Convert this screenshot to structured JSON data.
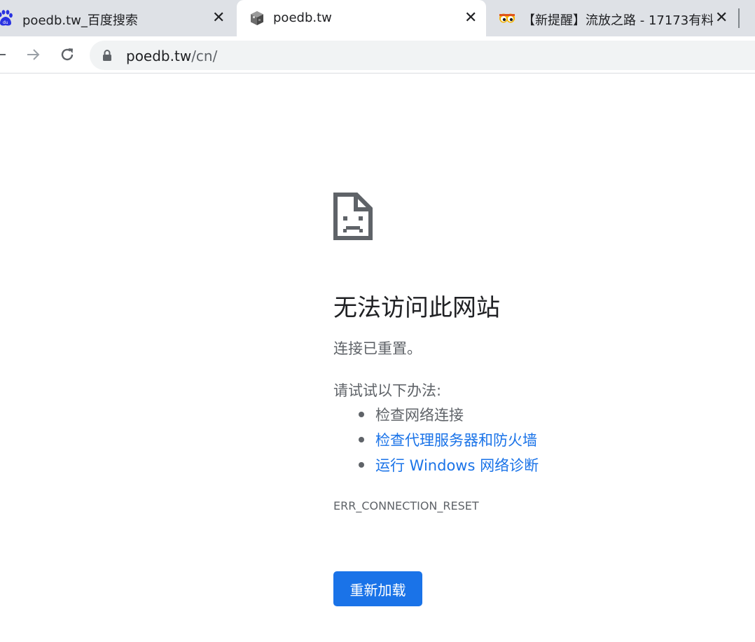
{
  "tabs": [
    {
      "title": "poedb.tw_百度搜索",
      "favicon": "baidu-paw-icon",
      "active": false
    },
    {
      "title": "poedb.tw",
      "favicon": "poedb-cube-icon",
      "active": true
    },
    {
      "title": "【新提醒】流放之路 - 17173有料",
      "favicon": "17173-eyes-icon",
      "active": false
    }
  ],
  "toolbar": {
    "back_icon": "back-arrow-icon",
    "forward_icon": "forward-arrow-icon",
    "reload_icon": "reload-icon",
    "lock_icon": "lock-icon",
    "url_host": "poedb.tw",
    "url_path": "/cn/"
  },
  "error_page": {
    "icon": "sad-document-icon",
    "heading": "无法访问此网站",
    "subtext": "连接已重置。",
    "try_label": "请试试以下办法:",
    "suggestions": [
      {
        "text": "检查网络连接",
        "link": false
      },
      {
        "text": "检查代理服务器和防火墙",
        "link": true
      },
      {
        "text": "运行 Windows 网络诊断",
        "link": true
      }
    ],
    "error_code": "ERR_CONNECTION_RESET",
    "reload_button": "重新加载"
  },
  "colors": {
    "accent": "#1a73e8",
    "text_primary": "#202124",
    "text_secondary": "#5f6368",
    "tabstrip_bg": "#dee1e6",
    "omnibox_bg": "#f1f3f4"
  }
}
